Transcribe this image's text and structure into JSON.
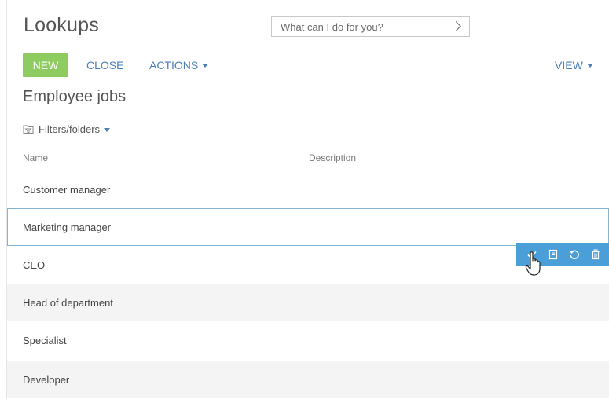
{
  "header": {
    "title": "Lookups",
    "command_placeholder": "What can I do for you?"
  },
  "toolbar": {
    "new_label": "NEW",
    "close_label": "CLOSE",
    "actions_label": "ACTIONS",
    "view_label": "VIEW"
  },
  "section_title": "Employee jobs",
  "filters_label": "Filters/folders",
  "table": {
    "columns": [
      "Name",
      "Description"
    ],
    "rows": [
      {
        "name": "Customer manager",
        "description": ""
      },
      {
        "name": "Marketing manager",
        "description": ""
      },
      {
        "name": "CEO",
        "description": ""
      },
      {
        "name": "Head of department",
        "description": ""
      },
      {
        "name": "Specialist",
        "description": ""
      },
      {
        "name": "Developer",
        "description": ""
      }
    ],
    "selected_row": 1
  },
  "row_actions": [
    "save-icon",
    "card-icon",
    "cancel-icon",
    "delete-icon"
  ],
  "colors": {
    "accent": "#4a9fd8",
    "new_button": "#8ecb60",
    "link": "#4b7fb8",
    "selected_border": "#83b6d4"
  }
}
